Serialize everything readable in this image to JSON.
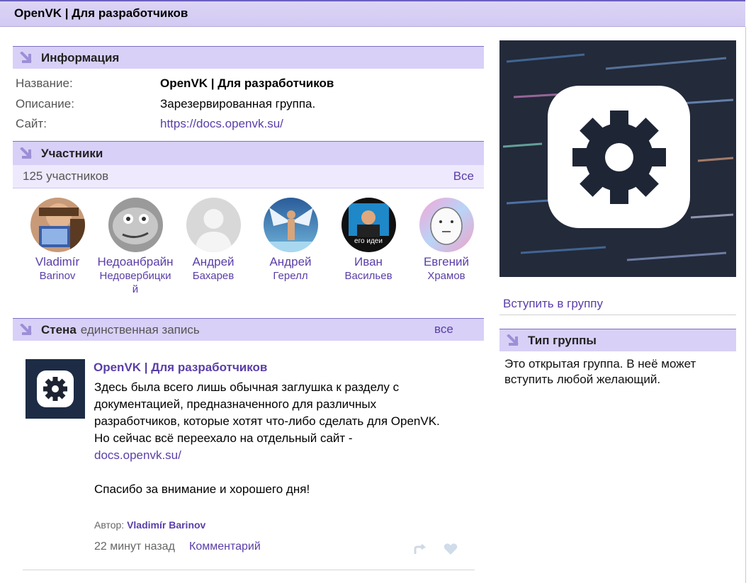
{
  "page": {
    "title": "OpenVK | Для разработчиков"
  },
  "info": {
    "section_title": "Информация",
    "rows": [
      {
        "label": "Название:",
        "value": "OpenVK | Для разработчиков"
      },
      {
        "label": "Описание:",
        "value": "Зарезервированная группа."
      },
      {
        "label": "Сайт:",
        "value": "https://docs.openvk.su/"
      }
    ]
  },
  "members": {
    "section_title": "Участники",
    "count_label": "125 участников",
    "all_label": "Все",
    "list": [
      {
        "first": "Vladimír",
        "last": "Barinov"
      },
      {
        "first": "Недоанбрайн",
        "last": "Недовербицкий"
      },
      {
        "first": "Андрей",
        "last": "Бахарев"
      },
      {
        "first": "Андрей",
        "last": "Герелл"
      },
      {
        "first": "Иван",
        "last": "Васильев",
        "avatar_caption": "его идеи"
      },
      {
        "first": "Евгений",
        "last": "Храмов"
      }
    ]
  },
  "wall": {
    "section_title": "Стена",
    "subtitle": "единственная запись",
    "all_label": "все",
    "post": {
      "author": "OpenVK | Для разработчиков",
      "lines": [
        "Здесь была всего лишь обычная заглушка к разделу с документацией, предназначенного для различных разработчиков, которые хотят что-либо сделать для OpenVK.",
        "Но сейчас всё переехало на отдельный сайт -"
      ],
      "link": "docs.openvk.su/",
      "closing": "Спасибо за внимание и хорошего дня!",
      "signed_label": "Автор:",
      "signed_name": "Vladimír Barinov",
      "time": "22 минут назад",
      "comment_label": "Комментарий"
    }
  },
  "sidebar": {
    "join_label": "Вступить в группу",
    "type_title": "Тип группы",
    "type_text": "Это открытая группа. В неё может вступить любой желающий."
  },
  "colors": {
    "accent": "#5a3ea8",
    "header_bg": "#d8d0f7",
    "members_bar_bg": "#efe9fd"
  }
}
